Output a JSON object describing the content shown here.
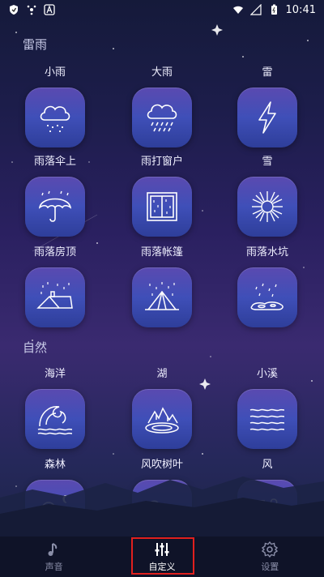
{
  "status_bar": {
    "time": "10:41"
  },
  "sections": [
    {
      "title": "雷雨",
      "items": [
        {
          "label": "小雨",
          "icon": "cloud-light-rain-icon"
        },
        {
          "label": "大雨",
          "icon": "cloud-heavy-rain-icon"
        },
        {
          "label": "雷",
          "icon": "lightning-icon"
        },
        {
          "label": "雨落伞上",
          "icon": "umbrella-rain-icon"
        },
        {
          "label": "雨打窗户",
          "icon": "window-rain-icon"
        },
        {
          "label": "雪",
          "icon": "snowflake-icon"
        },
        {
          "label": "雨落房顶",
          "icon": "roof-rain-icon"
        },
        {
          "label": "雨落帐篷",
          "icon": "tent-rain-icon"
        },
        {
          "label": "雨落水坑",
          "icon": "puddle-rain-icon"
        }
      ]
    },
    {
      "title": "自然",
      "items": [
        {
          "label": "海洋",
          "icon": "wave-icon"
        },
        {
          "label": "湖",
          "icon": "lake-icon"
        },
        {
          "label": "小溪",
          "icon": "stream-icon"
        },
        {
          "label": "森林",
          "icon": "forest-icon"
        },
        {
          "label": "风吹树叶",
          "icon": "leaves-wind-icon"
        },
        {
          "label": "风",
          "icon": "wind-icon"
        }
      ]
    }
  ],
  "tabs": [
    {
      "label": "声音",
      "icon": "music-note-icon",
      "active": false
    },
    {
      "label": "自定义",
      "icon": "sliders-icon",
      "active": true
    },
    {
      "label": "设置",
      "icon": "gear-icon",
      "active": false
    }
  ]
}
